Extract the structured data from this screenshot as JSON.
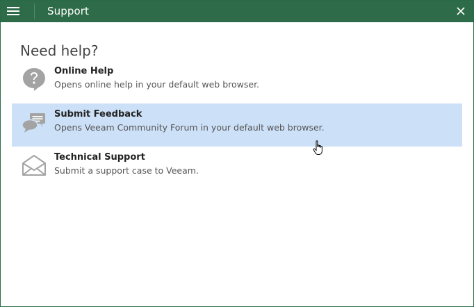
{
  "window": {
    "title": "Support"
  },
  "heading": "Need help?",
  "items": [
    {
      "label": "Online Help",
      "description": "Opens online help in your default web browser.",
      "icon": "question-bubble-icon",
      "selected": false
    },
    {
      "label": "Submit Feedback",
      "description": "Opens Veeam Community Forum in your default web browser.",
      "icon": "chat-bubbles-icon",
      "selected": true
    },
    {
      "label": "Technical Support",
      "description": "Submit a support case to Veeam.",
      "icon": "envelope-icon",
      "selected": false
    }
  ],
  "colors": {
    "titlebar": "#2e6b48",
    "selected_row": "#cce0f7",
    "icon_gray": "#a3a3a3"
  }
}
